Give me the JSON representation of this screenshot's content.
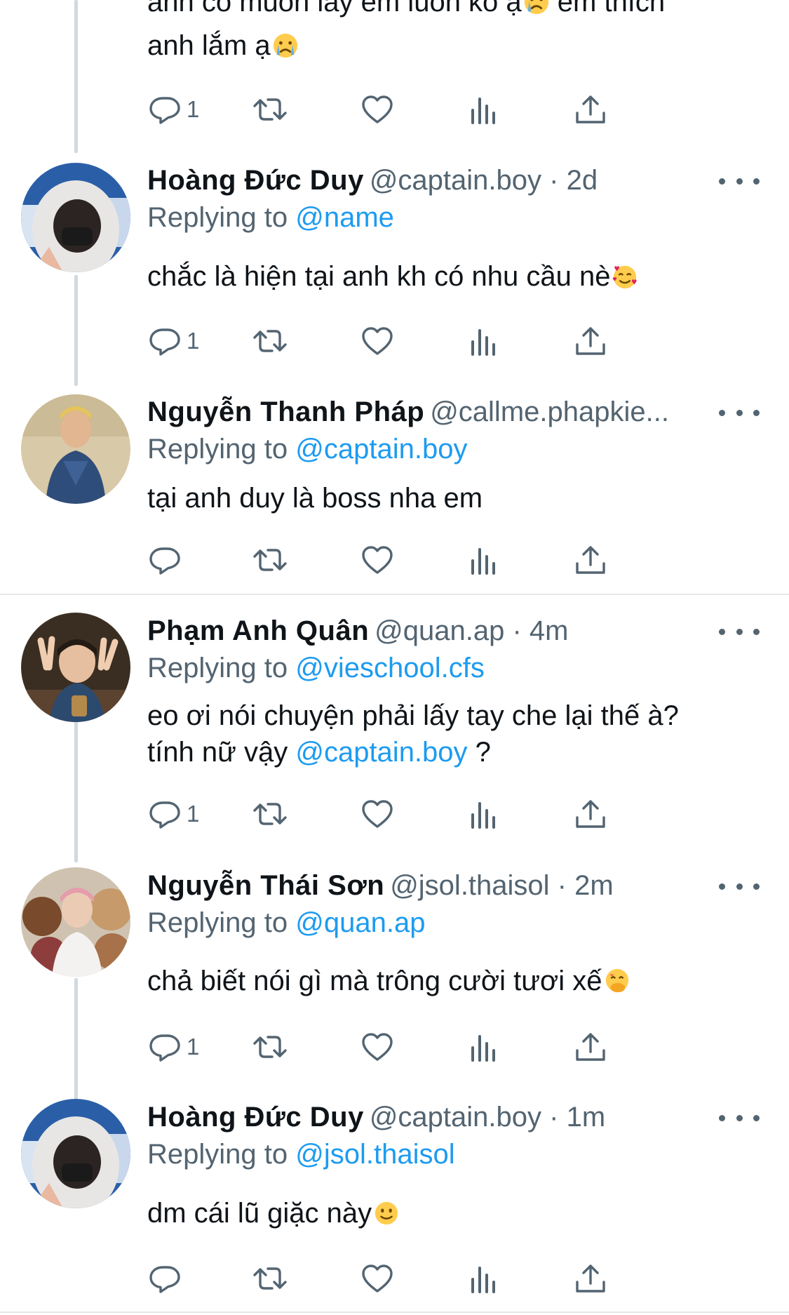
{
  "top_fragment": {
    "text_line1": "anh có muốn lấy em luôn ko ạ",
    "text_line1_tail": " em thích",
    "text_line2": "anh lắm ạ",
    "emoji": "crying-face",
    "reply_count": "1"
  },
  "tweets": [
    {
      "name": "Hoàng Đức Duy",
      "handle_time": "@captain.boy · 2d",
      "replying_label": "Replying to",
      "replying_to": "@name",
      "text": "chắc là hiện tại anh kh có nhu cầu nè",
      "emoji": "smiling-face-with-hearts",
      "reply_count": "1"
    },
    {
      "name": "Nguyễn Thanh Pháp",
      "handle_time": "@callme.phapkie...",
      "replying_label": "Replying to",
      "replying_to": "@captain.boy",
      "text": "tại anh duy là boss nha em",
      "reply_count": ""
    },
    {
      "name": "Phạm Anh Quân",
      "handle_time": "@quan.ap · 4m",
      "replying_label": "Replying to",
      "replying_to": "@vieschool.cfs",
      "text_line1": "eo ơi nói chuyện phải lấy tay che lại thế à?",
      "text_line2_prefix": "tính nữ vậy",
      "text_line2_mention": "@captain.boy",
      "text_line2_suffix": "?",
      "reply_count": "1"
    },
    {
      "name": "Nguyễn Thái Sơn",
      "handle_time": "@jsol.thaisol · 2m",
      "replying_label": "Replying to",
      "replying_to": "@quan.ap",
      "text": "chả biết nói gì mà trông cười tươi xế",
      "emoji": "face-with-hand-over-mouth",
      "reply_count": "1"
    },
    {
      "name": "Hoàng Đức Duy",
      "handle_time": "@captain.boy · 1m",
      "replying_label": "Replying to",
      "replying_to": "@jsol.thaisol",
      "text": "dm cái lũ giặc này",
      "emoji": "slightly-smiling-face",
      "reply_count": ""
    }
  ],
  "colors": {
    "text": "#0f1419",
    "secondary": "#536471",
    "link": "#1d9bf0",
    "thread_line": "#cfd9de",
    "divider": "#e4e8eb"
  },
  "icons": [
    "reply-icon",
    "retweet-icon",
    "like-icon",
    "analytics-icon",
    "share-icon",
    "more-icon"
  ]
}
